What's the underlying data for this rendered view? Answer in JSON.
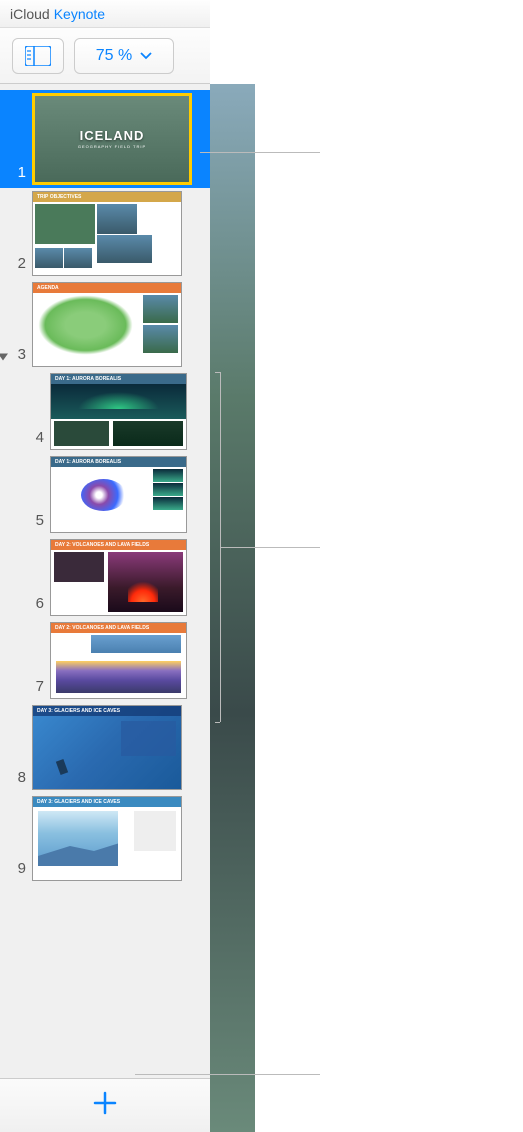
{
  "header": {
    "icloud_label": "iCloud",
    "app_label": "Keynote"
  },
  "toolbar": {
    "zoom_value": "75 %"
  },
  "slides": [
    {
      "number": "1",
      "selected": true,
      "indented": false,
      "has_disclosure": false,
      "thumb_class": "thumb-1",
      "title": "ICELAND",
      "subtitle": "GEOGRAPHY FIELD TRIP"
    },
    {
      "number": "2",
      "selected": false,
      "indented": false,
      "has_disclosure": false,
      "thumb_class": "thumb-2",
      "header_text": "TRIP OBJECTIVES"
    },
    {
      "number": "3",
      "selected": false,
      "indented": false,
      "has_disclosure": true,
      "thumb_class": "thumb-3",
      "header_text": "AGENDA"
    },
    {
      "number": "4",
      "selected": false,
      "indented": true,
      "has_disclosure": false,
      "thumb_class": "thumb-4",
      "header_text": "DAY 1: AURORA BOREALIS"
    },
    {
      "number": "5",
      "selected": false,
      "indented": true,
      "has_disclosure": false,
      "thumb_class": "thumb-5",
      "header_text": "DAY 1: AURORA BOREALIS"
    },
    {
      "number": "6",
      "selected": false,
      "indented": true,
      "has_disclosure": false,
      "thumb_class": "thumb-6",
      "header_text": "DAY 2: VOLCANOES AND LAVA FIELDS"
    },
    {
      "number": "7",
      "selected": false,
      "indented": true,
      "has_disclosure": false,
      "thumb_class": "thumb-7",
      "header_text": "DAY 2: VOLCANOES AND LAVA FIELDS"
    },
    {
      "number": "8",
      "selected": false,
      "indented": false,
      "has_disclosure": false,
      "thumb_class": "thumb-8",
      "header_text": "DAY 3: GLACIERS AND ICE CAVES"
    },
    {
      "number": "9",
      "selected": false,
      "indented": false,
      "has_disclosure": false,
      "thumb_class": "thumb-9",
      "header_text": "DAY 3: GLACIERS AND ICE CAVES"
    }
  ],
  "colors": {
    "accent": "#0a84ff",
    "selection_border": "#ffcc00"
  }
}
